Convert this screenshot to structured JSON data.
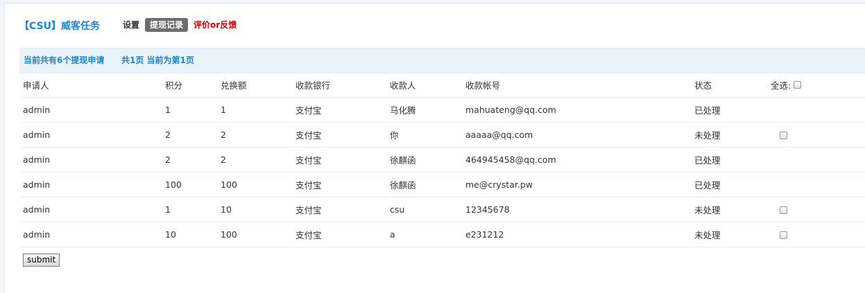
{
  "header": {
    "app_title": "【CSU】威客任务",
    "nav": {
      "settings": "设置",
      "withdraw_records": "提现记录",
      "feedback": "评价or反馈"
    }
  },
  "summary": {
    "count_text": "当前共有6个提现申请",
    "page_text": "共1页 当前为第1页"
  },
  "table": {
    "columns": {
      "applicant": "申请人",
      "points": "积分",
      "amount": "兑换额",
      "bank": "收款银行",
      "payee": "收款人",
      "account": "收款帐号",
      "status": "状态",
      "select_all": "全选:"
    },
    "rows": [
      {
        "applicant": "admin",
        "points": "1",
        "amount": "1",
        "bank": "支付宝",
        "payee": "马化腾",
        "account": "mahuateng@qq.com",
        "status": "已处理",
        "checkbox": false
      },
      {
        "applicant": "admin",
        "points": "2",
        "amount": "2",
        "bank": "支付宝",
        "payee": "你",
        "account": "aaaaa@qq.com",
        "status": "未处理",
        "checkbox": true
      },
      {
        "applicant": "admin",
        "points": "2",
        "amount": "2",
        "bank": "支付宝",
        "payee": "徐麒函",
        "account": "464945458@qq.com",
        "status": "已处理",
        "checkbox": false
      },
      {
        "applicant": "admin",
        "points": "100",
        "amount": "100",
        "bank": "支付宝",
        "payee": "徐麒函",
        "account": "me@crystar.pw",
        "status": "已处理",
        "checkbox": false
      },
      {
        "applicant": "admin",
        "points": "1",
        "amount": "10",
        "bank": "支付宝",
        "payee": "csu",
        "account": "12345678",
        "status": "未处理",
        "checkbox": true
      },
      {
        "applicant": "admin",
        "points": "10",
        "amount": "100",
        "bank": "支付宝",
        "payee": "a",
        "account": "e231212",
        "status": "未处理",
        "checkbox": true
      }
    ]
  },
  "actions": {
    "submit_label": "submit"
  }
}
